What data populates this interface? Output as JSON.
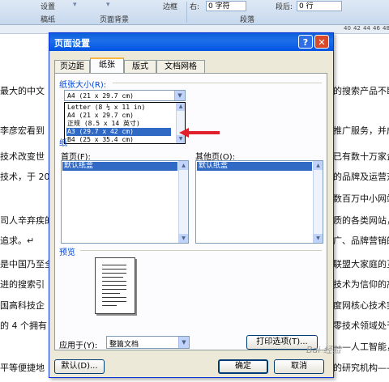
{
  "ribbon": {
    "setting_label": "设置",
    "border_label": "边框",
    "right_label": "右:",
    "right_value": "0 字符",
    "after_label": "段后:",
    "after_value": "0 行",
    "group_draft": "稿纸",
    "group_page_bg": "页面背景",
    "group_paragraph": "段落"
  },
  "ruler_numbers": [
    "40",
    "42",
    "44",
    "46",
    "48"
  ],
  "document": {
    "left_lines": [
      "最大的中文",
      "李彦宏看到",
      "技术改变世",
      "技术，于 20",
      "司人辛弃疾的",
      "追求。↵",
      "是中国乃至全",
      "进的搜索引",
      "国高科技企",
      "的 4 个拥有",
      "平等便捷地"
    ],
    "right_lines": [
      "的搜索产品不断",
      "推广服务，并成",
      "已有数十万家企",
      "的品牌及运营对",
      "数百万中小网站",
      "质的各类网站，",
      "广、品牌营销的",
      "联盟大家庭的互",
      "技术为信仰的高",
      "度网核心技术突",
      "零技术领域处于",
      "——人工智能，",
      "的研究机构——"
    ]
  },
  "dialog": {
    "title": "页面设置",
    "help": "?",
    "close": "✕",
    "tabs": [
      "页边距",
      "纸张",
      "版式",
      "文档网格"
    ],
    "active_tab": "纸张",
    "paper_size_label": "纸张大小(R):",
    "paper_size_value": "A4 (21 x 29.7 cm)",
    "paper_size_options": [
      "Letter (8 ½ x 11 in)",
      "A4 (21 x 29.7 cm)",
      "正规 (8.5 x 14 英寸)",
      "A3 (29.7 x 42 cm)",
      "B4 (25 x 35.4 cm)"
    ],
    "selected_option": "A3 (29.7 x 42 cm)",
    "paper_source_label": "纸",
    "first_page_label": "首页(F):",
    "first_page_value": "默认纸盒",
    "other_pages_label": "其他页(O):",
    "other_pages_value": "默认纸盒",
    "preview_label": "预览",
    "apply_to_label": "应用于(Y):",
    "apply_to_value": "整篇文档",
    "print_options_button": "打印选项(T)...",
    "default_button": "默认(D)...",
    "ok_button": "确定",
    "cancel_button": "取消"
  },
  "annotation": {
    "arrow_color": "#e0202a"
  },
  "watermark": "Bai 经验"
}
